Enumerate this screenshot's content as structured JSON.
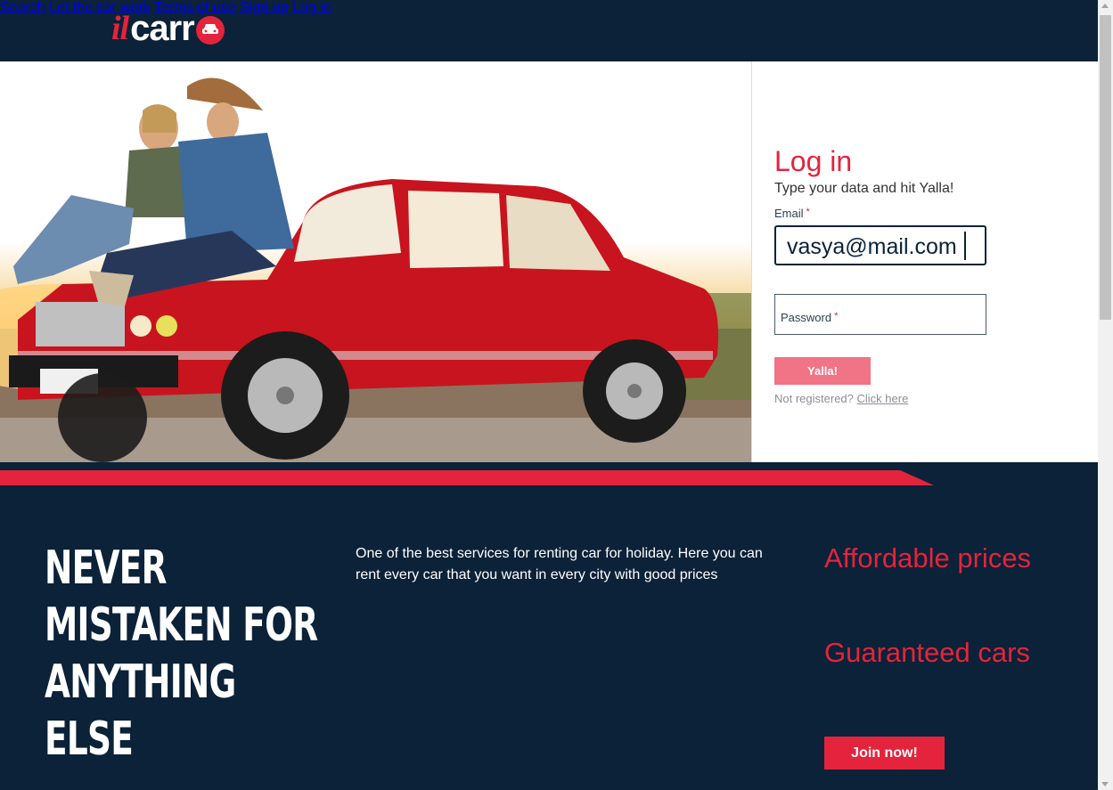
{
  "brand": {
    "logo_il": "il",
    "logo_carr": "carr"
  },
  "nav": {
    "search": "Search",
    "let_car_work": "Let the car work",
    "terms": "Terms of use",
    "sign_up": "Sign up",
    "log_in": "Log in"
  },
  "login": {
    "title": "Log in",
    "subtitle": "Type your data and hit Yalla!",
    "email_label": "Email",
    "email_value": "vasya@mail.com",
    "password_label": "Password",
    "required_mark": "*",
    "submit": "Yalla!",
    "not_registered": "Not registered?",
    "click_here": "Click here"
  },
  "bottom": {
    "slogan": [
      "NEVER",
      "MISTAKEN FOR",
      "ANYTHING",
      "ELSE"
    ],
    "about": "One of the best services for renting car for holiday. Here you can rent every car that you want in every city with good prices",
    "feature_1": "Affordable prices",
    "feature_2": "Guaranteed cars",
    "join": "Join now!"
  },
  "colors": {
    "navy": "#0b2238",
    "accent_red": "#e3243c",
    "yalla_pink": "#f07386",
    "car_red": "#c8141e"
  },
  "icons": {
    "logo_o": "car-front-icon"
  }
}
